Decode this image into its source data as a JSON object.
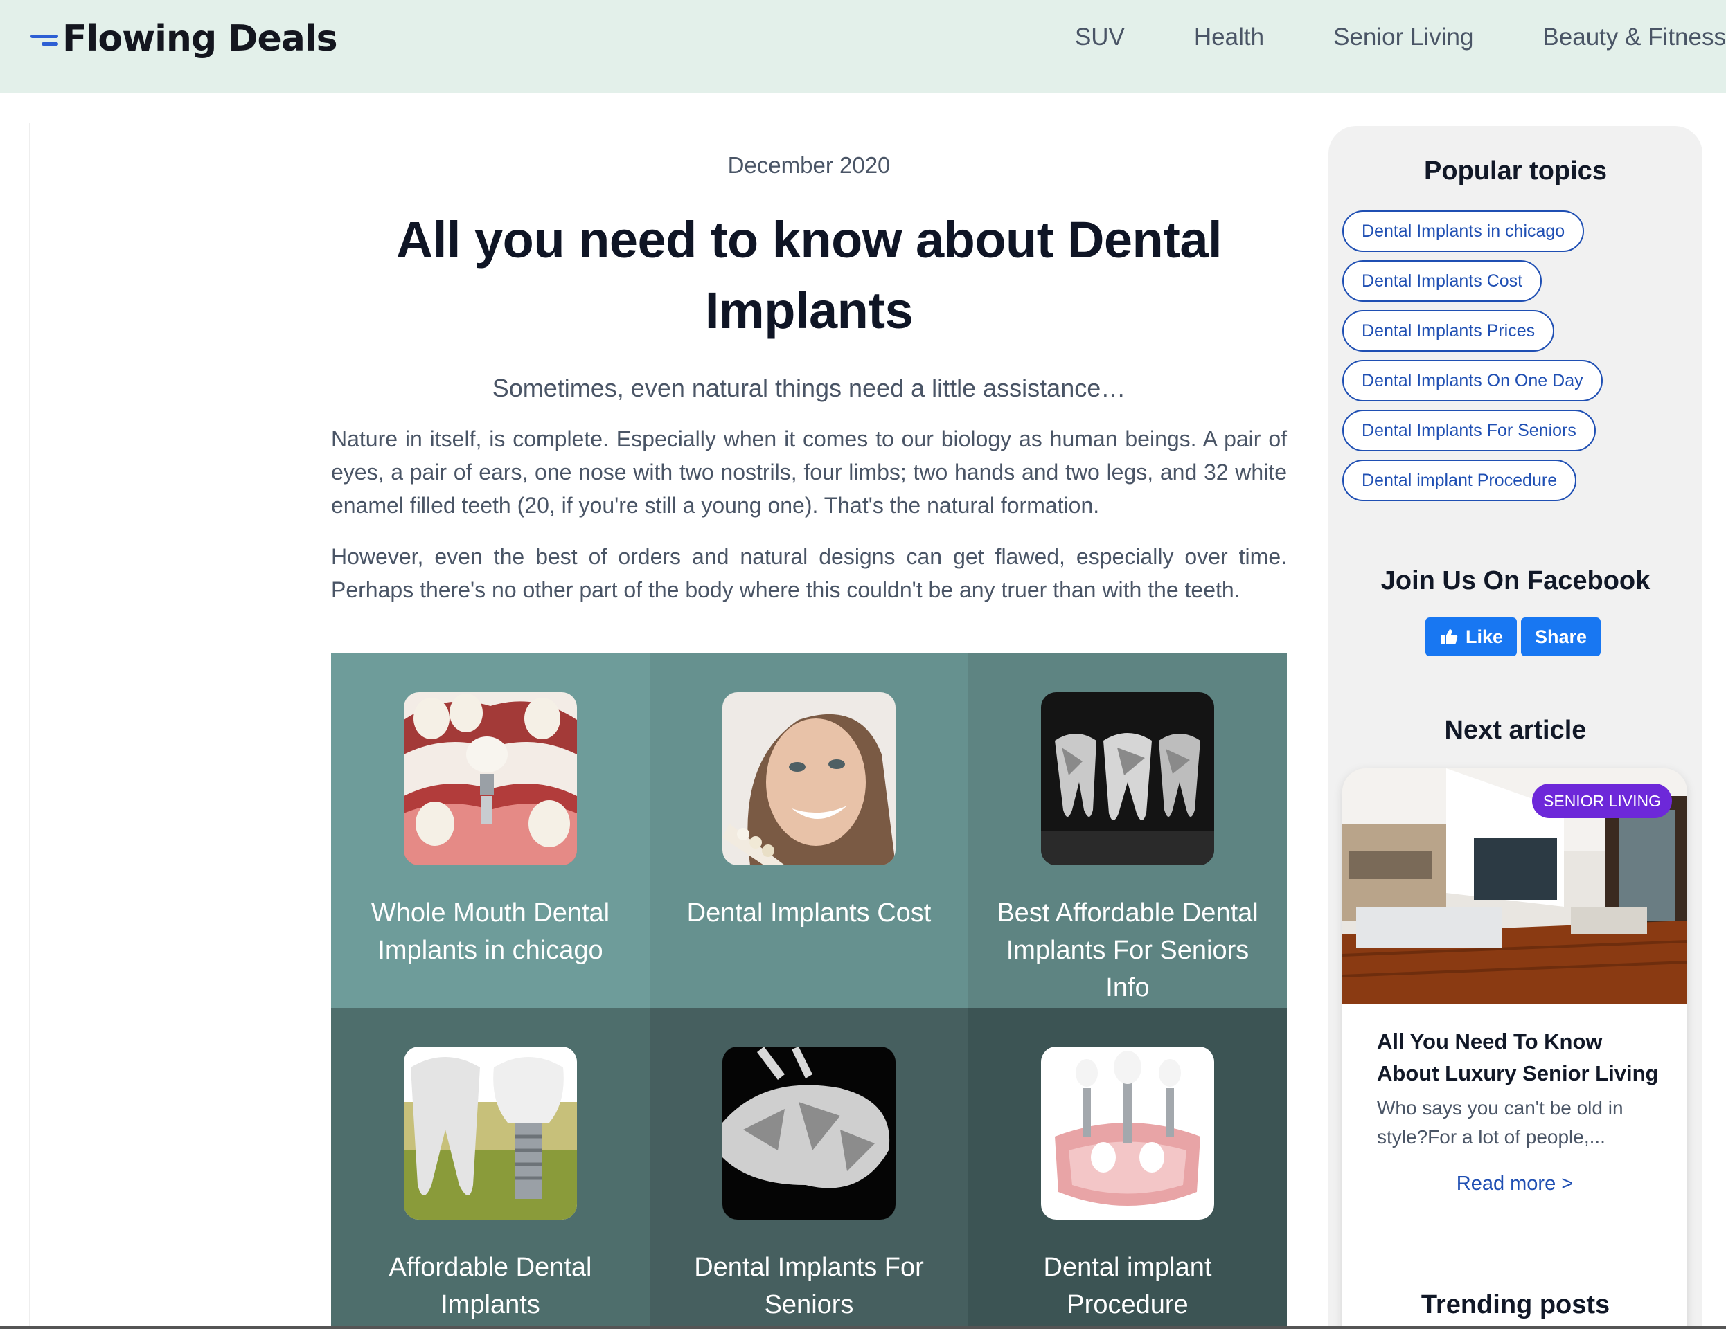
{
  "header": {
    "brand": "Flowing Deals",
    "nav": [
      "SUV",
      "Health",
      "Senior Living",
      "Beauty & Fitness"
    ]
  },
  "article": {
    "date": "December 2020",
    "title_line1": "All you need to know about Dental",
    "title_line2": "Implants",
    "subtitle": "Sometimes, even natural things need a little assistance…",
    "paragraphs": [
      "Nature in itself, is complete. Especially when it comes to our biology as human beings. A pair of eyes, a pair of ears, one nose with two nostrils, four limbs; two hands and two legs, and 32 white enamel filled teeth (20, if you're still a young one). That's the natural formation.",
      "However, even the best of orders and natural designs can get flawed, especially over time. Perhaps there's no other part of the body where this couldn't be any truer than with the teeth."
    ]
  },
  "tiles": [
    {
      "line1": "Whole Mouth Dental",
      "line2": "Implants in chicago",
      "bg": "#6e9c9a"
    },
    {
      "line1": "Dental Implants Cost",
      "line2": "",
      "bg": "#66918f"
    },
    {
      "line1": "Best Affordable Dental",
      "line2": "Implants For Seniors Info",
      "bg": "#5e8482"
    },
    {
      "line1": "Affordable Dental",
      "line2": "Implants",
      "bg": "#4e6e6c"
    },
    {
      "line1": "Dental Implants For",
      "line2": "Seniors",
      "bg": "#465f5f"
    },
    {
      "line1": "Dental implant",
      "line2": "Procedure",
      "bg": "#3c5454"
    }
  ],
  "sidebar": {
    "popular_heading": "Popular topics",
    "topics": [
      "Dental Implants in chicago",
      "Dental Implants Cost",
      "Dental Implants Prices",
      "Dental Implants On One Day",
      "Dental Implants For Seniors",
      "Dental implant Procedure"
    ],
    "facebook_heading": "Join Us On Facebook",
    "like_label": "Like",
    "share_label": "Share",
    "next_heading": "Next article",
    "next": {
      "badge": "SENIOR LIVING",
      "title": "All You Need To Know About Luxury Senior Living",
      "excerpt": "Who says you can't be old in style?For a lot of people,...",
      "read_more": "Read more >"
    },
    "trending_heading": "Trending posts"
  },
  "colors": {
    "header_bg": "#e3f0ea",
    "brand_accent": "#2d5fd4",
    "link": "#1f4fb3",
    "facebook": "#1877f2",
    "badge": "#6d28d9"
  }
}
